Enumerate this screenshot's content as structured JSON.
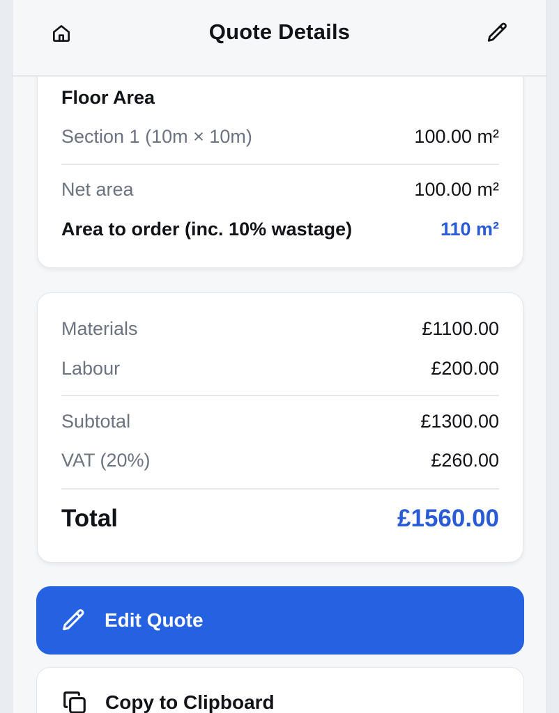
{
  "header": {
    "title": "Quote Details",
    "home_icon": "home-icon",
    "edit_icon": "pencil-icon"
  },
  "floor_area": {
    "title": "Floor Area",
    "sections": [
      {
        "label": "Section 1 (10m × 10m)",
        "value": "100.00 m²"
      }
    ],
    "net_area_label": "Net area",
    "net_area_value": "100.00 m²",
    "order_label": "Area to order (inc. 10% wastage)",
    "order_value": "110 m²"
  },
  "costs": {
    "materials_label": "Materials",
    "materials_value": "£1100.00",
    "labour_label": "Labour",
    "labour_value": "£200.00",
    "subtotal_label": "Subtotal",
    "subtotal_value": "£1300.00",
    "vat_label": "VAT (20%)",
    "vat_value": "£260.00",
    "total_label": "Total",
    "total_value": "£1560.00"
  },
  "actions": {
    "edit_label": "Edit Quote",
    "copy_label": "Copy to Clipboard"
  },
  "colors": {
    "accent": "#2a5bd7",
    "primary_button": "#2462e2",
    "background": "#f6f7f9"
  }
}
